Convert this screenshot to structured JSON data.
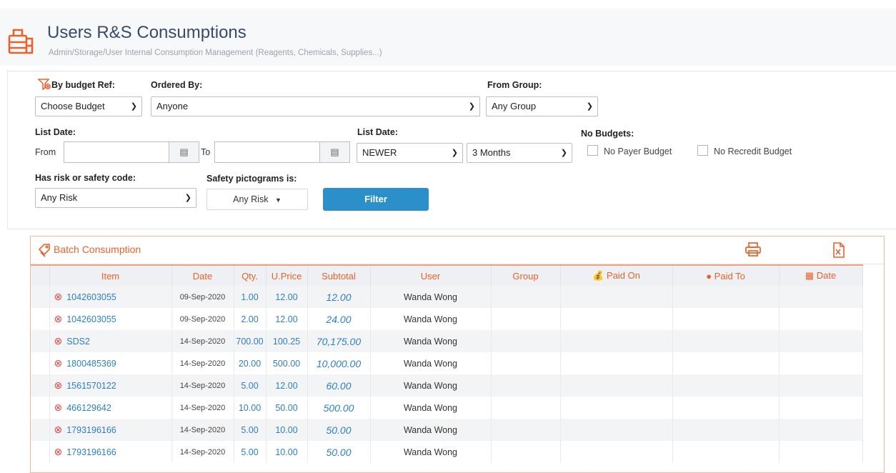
{
  "header": {
    "title": "Users R&S Consumptions",
    "subtitle": "Admin/Storage/User Internal Consumption Management (Reagents, Chemicals, Supplies...)"
  },
  "filters": {
    "by_budget_label": "By budget Ref:",
    "budget_value": "Choose Budget",
    "ordered_by_label": "Ordered By:",
    "ordered_by_value": "Anyone",
    "from_group_label": "From Group:",
    "group_value": "Any Group",
    "list_date_label": "List Date:",
    "from_label": "From",
    "to_label": "To",
    "list_date2_label": "List Date:",
    "newer_value": "NEWER",
    "months_value": "3 Months",
    "no_budgets_label": "No Budgets:",
    "no_payer_label": "No Payer Budget",
    "no_recredit_label": "No Recredit Budget",
    "risk_label": "Has risk or safety code:",
    "risk_value": "Any Risk",
    "pictograms_label": "Safety pictograms is:",
    "pictograms_value": "Any Risk",
    "filter_button": "Filter"
  },
  "table": {
    "section_title": "Batch Consumption",
    "columns": {
      "item": "Item",
      "date": "Date",
      "qty": "Qty.",
      "uprice": "U.Price",
      "subtotal": "Subtotal",
      "user": "User",
      "group": "Group",
      "paid_on": "Paid On",
      "paid_to": "Paid To",
      "date2": "Date"
    },
    "rows": [
      {
        "item": "1042603055",
        "date": "09-Sep-2020",
        "qty": "1.00",
        "uprice": "12.00",
        "subtotal": "12.00",
        "user": "Wanda Wong"
      },
      {
        "item": "1042603055",
        "date": "09-Sep-2020",
        "qty": "2.00",
        "uprice": "12.00",
        "subtotal": "24.00",
        "user": "Wanda Wong"
      },
      {
        "item": "SDS2",
        "date": "14-Sep-2020",
        "qty": "700.00",
        "uprice": "100.25",
        "subtotal": "70,175.00",
        "user": "Wanda Wong"
      },
      {
        "item": "1800485369",
        "date": "14-Sep-2020",
        "qty": "20.00",
        "uprice": "500.00",
        "subtotal": "10,000.00",
        "user": "Wanda Wong"
      },
      {
        "item": "1561570122",
        "date": "14-Sep-2020",
        "qty": "5.00",
        "uprice": "12.00",
        "subtotal": "60.00",
        "user": "Wanda Wong"
      },
      {
        "item": "466129642",
        "date": "14-Sep-2020",
        "qty": "10.00",
        "uprice": "50.00",
        "subtotal": "500.00",
        "user": "Wanda Wong"
      },
      {
        "item": "1793196166",
        "date": "14-Sep-2020",
        "qty": "5.00",
        "uprice": "10.00",
        "subtotal": "50.00",
        "user": "Wanda Wong"
      },
      {
        "item": "1793196166",
        "date": "14-Sep-2020",
        "qty": "5.00",
        "uprice": "10.00",
        "subtotal": "50.00",
        "user": "Wanda Wong"
      }
    ]
  },
  "colors": {
    "accent": "#e8622c",
    "link": "#2f7fc3",
    "button": "#2b8fc9"
  },
  "icons": {
    "header": "storage-boxes-icon",
    "budget_filter": "funnel-icon",
    "calendar": "calendar-icon",
    "batch": "tags-icon",
    "print": "printer-icon",
    "excel": "excel-file-icon",
    "remove": "remove-circle-icon",
    "paid_on": "hand-coin-icon",
    "paid_to": "money-bag-icon",
    "date_col": "calendar-icon"
  }
}
